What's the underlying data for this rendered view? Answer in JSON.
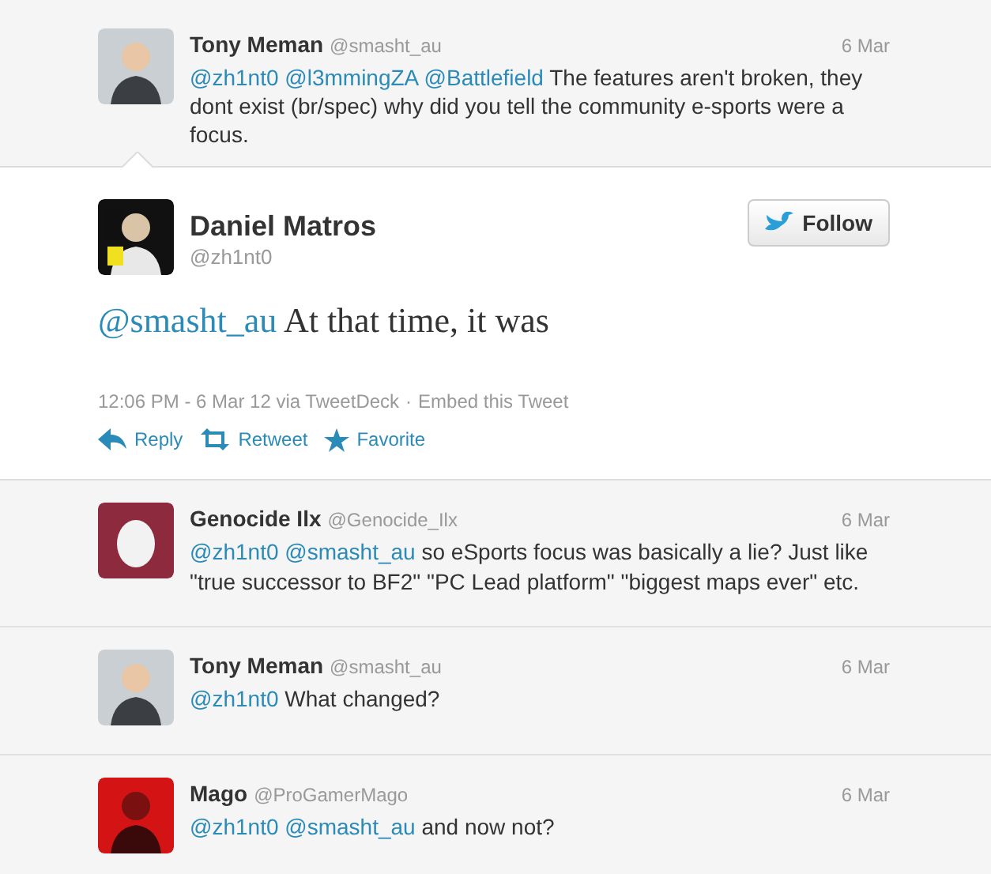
{
  "parent_tweet": {
    "avatar": {
      "kind": "cartoon"
    },
    "name": "Tony Meman",
    "handle": "@smasht_au",
    "date": "6 Mar",
    "segments": [
      {
        "kind": "mention",
        "text": "@zh1nt0"
      },
      {
        "kind": "mention",
        "text": "@l3mmingZA"
      },
      {
        "kind": "mention",
        "text": "@Battlefield"
      },
      {
        "kind": "text",
        "text": "The features aren't broken, they dont exist (br/spec) why did you tell the community e-sports were a focus."
      }
    ]
  },
  "main_tweet": {
    "name": "Daniel Matros",
    "handle": "@zh1nt0",
    "follow_label": "Follow",
    "segments": [
      {
        "kind": "mention",
        "text": "@smasht_au"
      },
      {
        "kind": "text",
        "text": "At that time, it was"
      }
    ],
    "timestamp": "12:06 PM - 6 Mar 12 via TweetDeck",
    "separator": "·",
    "embed_link": "Embed this Tweet",
    "actions": [
      {
        "kind": "reply",
        "label": "Reply"
      },
      {
        "kind": "retweet",
        "label": "Retweet"
      },
      {
        "kind": "favorite",
        "label": "Favorite"
      }
    ]
  },
  "replies": [
    {
      "avatar": {
        "kind": "egg"
      },
      "name": "Genocide Ilx",
      "handle": "@Genocide_Ilx",
      "date": "6 Mar",
      "segments": [
        {
          "kind": "mention",
          "text": "@zh1nt0"
        },
        {
          "kind": "mention",
          "text": "@smasht_au"
        },
        {
          "kind": "text",
          "text": "so eSports focus was basically a lie? Just like \"true successor to BF2\" \"PC Lead platform\" \"biggest maps ever\" etc."
        }
      ]
    },
    {
      "avatar": {
        "kind": "cartoon"
      },
      "name": "Tony Meman",
      "handle": "@smasht_au",
      "date": "6 Mar",
      "segments": [
        {
          "kind": "mention",
          "text": "@zh1nt0"
        },
        {
          "kind": "text",
          "text": "What changed?"
        }
      ]
    },
    {
      "avatar": {
        "kind": "red"
      },
      "name": "Mago",
      "handle": "@ProGamerMago",
      "date": "6 Mar",
      "segments": [
        {
          "kind": "mention",
          "text": "@zh1nt0"
        },
        {
          "kind": "mention",
          "text": "@smasht_au"
        },
        {
          "kind": "text",
          "text": "and now not?"
        }
      ]
    }
  ]
}
